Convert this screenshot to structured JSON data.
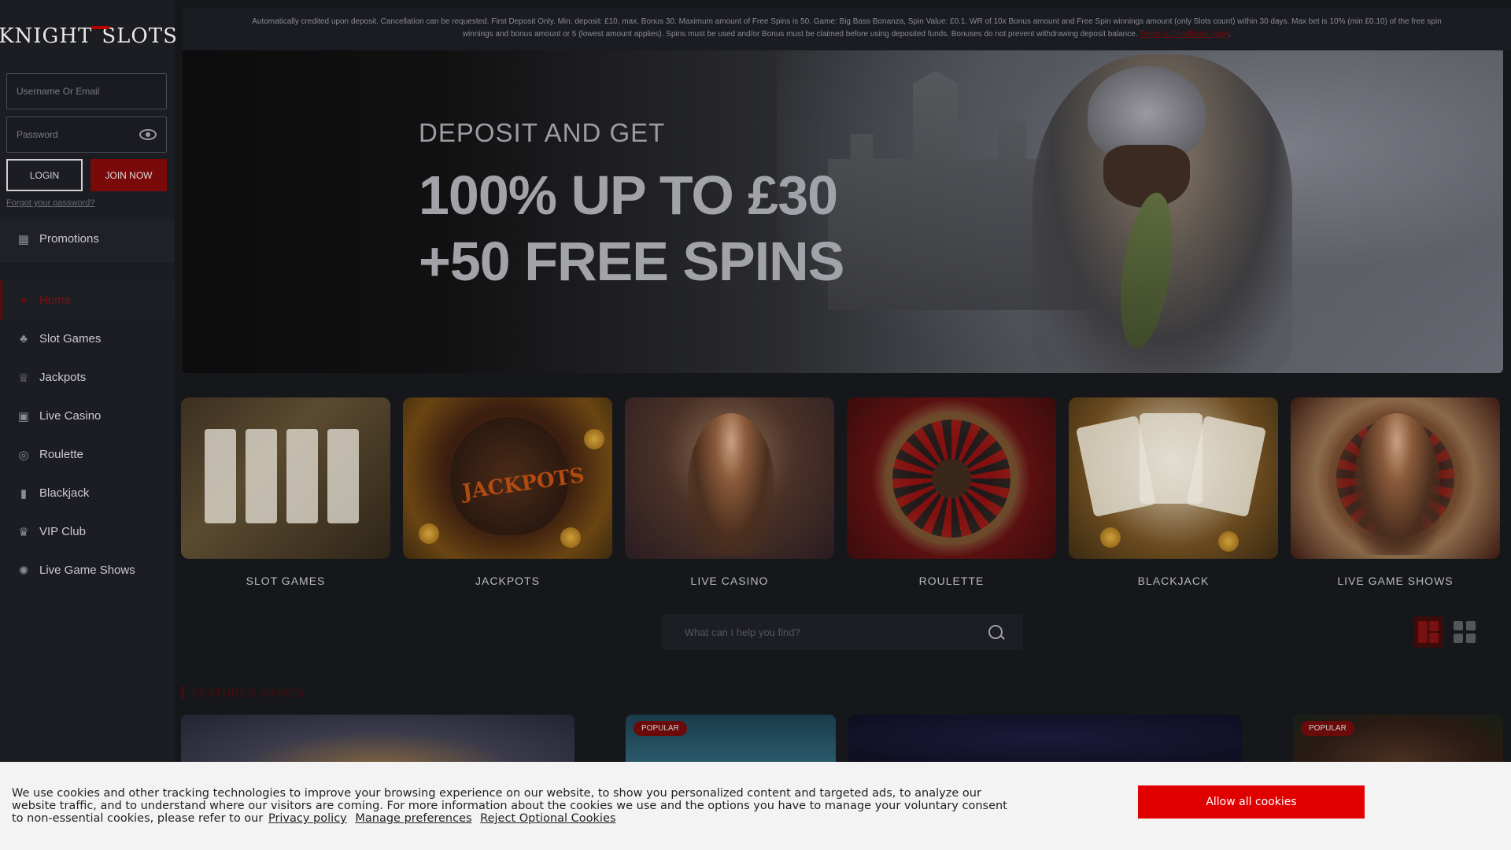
{
  "brand": {
    "left": "KNIGHT",
    "right": "SLOTS"
  },
  "login": {
    "username_placeholder": "Username Or Email",
    "password_placeholder": "Password",
    "login_label": "LOGIN",
    "join_label": "JOIN NOW",
    "forgot_label": "Forgot your password?"
  },
  "sidebar": {
    "items": [
      {
        "label": "Promotions",
        "icon": "promotions-icon"
      },
      {
        "label": "Home",
        "icon": "home-icon",
        "active": true
      },
      {
        "label": "Slot Games",
        "icon": "slots-icon"
      },
      {
        "label": "Jackpots",
        "icon": "trophy-icon"
      },
      {
        "label": "Live Casino",
        "icon": "live-casino-icon"
      },
      {
        "label": "Roulette",
        "icon": "roulette-icon"
      },
      {
        "label": "Blackjack",
        "icon": "cards-icon"
      },
      {
        "label": "VIP Club",
        "icon": "crown-icon"
      },
      {
        "label": "Live Game Shows",
        "icon": "wheel-icon"
      }
    ]
  },
  "notice": {
    "line1": "Automatically credited upon deposit. Cancellation can be requested. First Deposit Only. Min. deposit: £10, max. Bonus 30. Maximum amount of Free Spins is 50. Game: Big Bass Bonanza, Spin Value: £0.1. WR of 10x Bonus amount and Free Spin winnings amount (only Slots count) within 30 days. Max bet is 10% (min £0.10) of the free spin",
    "line2": "winnings and bonus amount or 5 (lowest amount applies). Spins must be used and/or Bonus must be claimed before using deposited funds. Bonuses do not prevent withdrawing deposit balance.",
    "link": "Terms & Conditions Apply"
  },
  "hero": {
    "subtitle": "DEPOSIT AND GET",
    "line1": "100% UP TO £30",
    "line2": "+50 FREE SPINS"
  },
  "categories": [
    {
      "label": "SLOT GAMES"
    },
    {
      "label": "JACKPOTS"
    },
    {
      "label": "LIVE CASINO"
    },
    {
      "label": "ROULETTE"
    },
    {
      "label": "BLACKJACK"
    },
    {
      "label": "LIVE GAME SHOWS"
    }
  ],
  "jackpot_art_text": "JACKPOTS",
  "search": {
    "placeholder": "What can I help you find?"
  },
  "featured": {
    "title": "FEATURED GAMES",
    "badge": "POPULAR"
  },
  "cookie": {
    "text": "We use cookies and other tracking technologies to improve your browsing experience on our website, to show you personalized content and targeted ads, to analyze our website traffic, and to understand where our visitors are coming. For more information about the cookies we use and the options you have to manage your voluntary consent to non-essential cookies, please refer to our",
    "privacy": "Privacy policy",
    "manage": "Manage preferences",
    "reject": "Reject Optional Cookies",
    "allow": "Allow all cookies"
  },
  "colors": {
    "accent": "#e00000",
    "dark_red": "#7a0a0a",
    "background": "#16171b"
  }
}
